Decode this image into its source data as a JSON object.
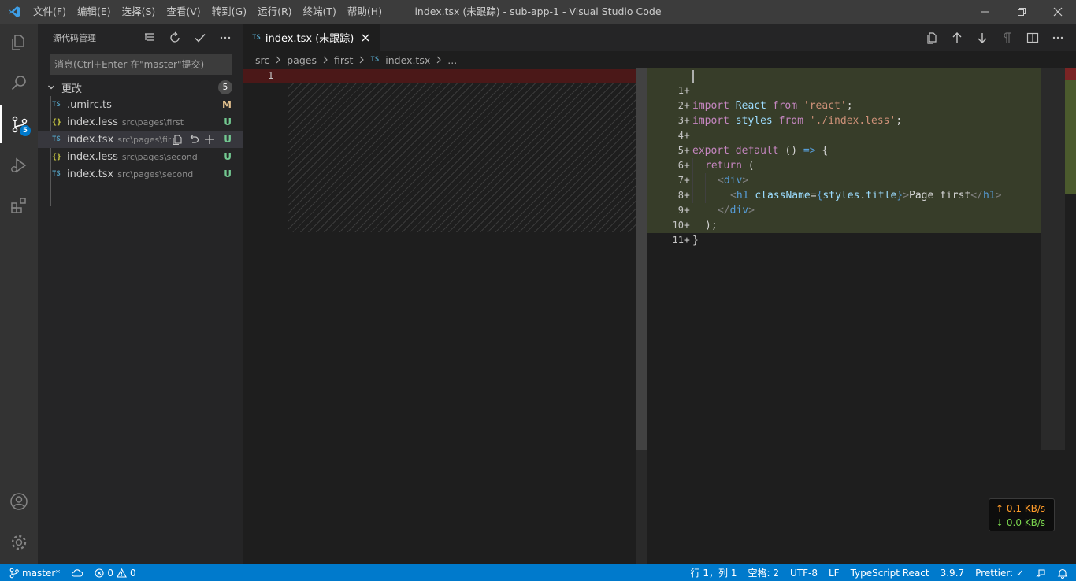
{
  "titlebar": {
    "menus": [
      "文件(F)",
      "编辑(E)",
      "选择(S)",
      "查看(V)",
      "转到(G)",
      "运行(R)",
      "终端(T)",
      "帮助(H)"
    ],
    "window_title": "index.tsx (未跟踪) - sub-app-1 - Visual Studio Code"
  },
  "activitybar": {
    "scm_badge": "5"
  },
  "sidebar": {
    "title": "源代码管理",
    "commit_placeholder": "消息(Ctrl+Enter 在\"master\"提交)",
    "changes_label": "更改",
    "changes_count": "5",
    "files": [
      {
        "icon": "TS",
        "name": ".umirc.ts",
        "path": "",
        "status": "M"
      },
      {
        "icon": "{}",
        "name": "index.less",
        "path": "src\\pages\\first",
        "status": "U"
      },
      {
        "icon": "TS",
        "name": "index.tsx",
        "path": "src\\pages\\first",
        "status": "U"
      },
      {
        "icon": "{}",
        "name": "index.less",
        "path": "src\\pages\\second",
        "status": "U"
      },
      {
        "icon": "TS",
        "name": "index.tsx",
        "path": "src\\pages\\second",
        "status": "U"
      }
    ]
  },
  "editor": {
    "tab_icon": "TS",
    "tab_label": "index.tsx (未跟踪)",
    "breadcrumb": [
      "src",
      "pages",
      "first",
      "index.tsx",
      "..."
    ],
    "breadcrumb_ts_icon": "TS",
    "left_line_number": "1",
    "left_line_marker": "—",
    "lines": [
      {
        "n": "1",
        "mark": "+"
      },
      {
        "n": "2",
        "mark": "+"
      },
      {
        "n": "3",
        "mark": "+"
      },
      {
        "n": "4",
        "mark": "+"
      },
      {
        "n": "5",
        "mark": "+"
      },
      {
        "n": "6",
        "mark": "+"
      },
      {
        "n": "7",
        "mark": "+"
      },
      {
        "n": "8",
        "mark": "+"
      },
      {
        "n": "9",
        "mark": "+"
      },
      {
        "n": "10",
        "mark": "+"
      },
      {
        "n": "11",
        "mark": "+"
      }
    ],
    "code": {
      "l1": [
        "import",
        " React ",
        "from",
        " ",
        "'react'",
        ";"
      ],
      "l2": [
        "import",
        " styles ",
        "from",
        " ",
        "'./index.less'",
        ";"
      ],
      "l4": [
        "export",
        " ",
        "default",
        " () ",
        "=>",
        " {"
      ],
      "l5": [
        "return",
        " ("
      ],
      "l6": [
        "<",
        "div",
        ">"
      ],
      "l7": [
        "<",
        "h1",
        " ",
        "className",
        "=",
        "{",
        "styles",
        ".",
        "title",
        "}",
        ">",
        "Page first",
        "</",
        "h1",
        ">"
      ],
      "l8": [
        "</",
        "div",
        ">"
      ],
      "l9": [
        ");"
      ],
      "l10": [
        "}"
      ]
    }
  },
  "netspeed": {
    "up": "↑ 0.1 KB/s",
    "down": "↓ 0.0 KB/s"
  },
  "statusbar": {
    "branch": "master*",
    "errors": "0",
    "warnings": "0",
    "position": "行 1，列 1",
    "spaces": "空格: 2",
    "encoding": "UTF-8",
    "eol": "LF",
    "language": "TypeScript React",
    "version": "3.9.7",
    "prettier": "Prettier: ✓"
  },
  "colors": {
    "accent": "#007acc",
    "deleted_bg": "#4b1818",
    "inserted_bg": "#373d29",
    "modified": "#e2c08d",
    "untracked": "#73c991"
  }
}
